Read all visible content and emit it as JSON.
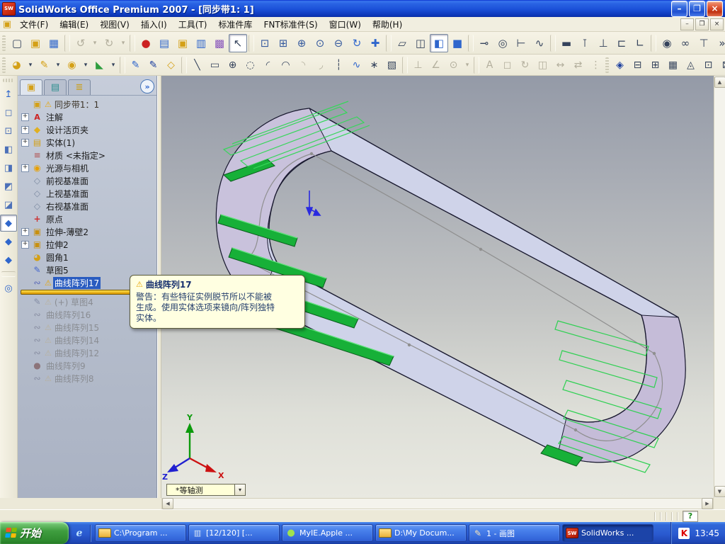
{
  "window": {
    "title": "SolidWorks Office Premium 2007 - [同步带1: 1]",
    "app_badge": "SW",
    "controls": {
      "min": "–",
      "restore": "❐",
      "close": "×"
    }
  },
  "menu": {
    "items": [
      "文件(F)",
      "编辑(E)",
      "视图(V)",
      "插入(I)",
      "工具(T)",
      "标准件库",
      "FNT标准件(S)",
      "窗口(W)",
      "帮助(H)"
    ],
    "doc_icon_glyph": "▣"
  },
  "toolbar_standard": {
    "icons": [
      {
        "n": "toolbar-grip",
        "g": "",
        "c": "grip",
        "inter": "false"
      },
      {
        "n": "new-document-icon",
        "g": "▢",
        "c": "c-ink"
      },
      {
        "n": "open-document-icon",
        "g": "▣",
        "c": "c-gold"
      },
      {
        "n": "save-icon",
        "g": "▦",
        "c": "c-blue"
      },
      {
        "n": "separator",
        "g": "",
        "c": "tsep",
        "inter": "false"
      },
      {
        "n": "undo-icon",
        "g": "↺",
        "c": "c-gray"
      },
      {
        "n": "undo-dropdown-icon",
        "g": "▾",
        "c": "c-gray dd"
      },
      {
        "n": "redo-icon",
        "g": "↻",
        "c": "c-gray"
      },
      {
        "n": "redo-dropdown-icon",
        "g": "▾",
        "c": "c-gray dd"
      },
      {
        "n": "separator",
        "g": "",
        "c": "tsep",
        "inter": "false"
      },
      {
        "n": "rebuild-traffic-light-icon",
        "g": "●",
        "c": "c-traffic"
      },
      {
        "n": "file-properties-icon",
        "g": "▤",
        "c": "c-blue"
      },
      {
        "n": "design-library-icon",
        "g": "▣",
        "c": "c-gold"
      },
      {
        "n": "task-list-icon",
        "g": "▥",
        "c": "c-blue"
      },
      {
        "n": "color-palette-icon",
        "g": "▩",
        "c": "c-purple"
      },
      {
        "n": "select-arrow-icon",
        "g": "↖",
        "c": "c-ink pressed"
      },
      {
        "n": "separator",
        "g": "",
        "c": "tsep",
        "inter": "false"
      },
      {
        "n": "zoom-to-fit-icon",
        "g": "⊡",
        "c": "c-zoom"
      },
      {
        "n": "zoom-to-area-icon",
        "g": "⊞",
        "c": "c-zoom"
      },
      {
        "n": "zoom-in-out-icon",
        "g": "⊕",
        "c": "c-zoom"
      },
      {
        "n": "zoom-to-selection-icon",
        "g": "⊙",
        "c": "c-zoom"
      },
      {
        "n": "zoom-out-icon",
        "g": "⊖",
        "c": "c-zoom"
      },
      {
        "n": "rotate-view-icon",
        "g": "↻",
        "c": "c-blue"
      },
      {
        "n": "pan-icon",
        "g": "✚",
        "c": "c-blue"
      },
      {
        "n": "separator",
        "g": "",
        "c": "tsep",
        "inter": "false"
      },
      {
        "n": "wireframe-icon",
        "g": "▱",
        "c": "c-ink"
      },
      {
        "n": "hidden-lines-icon",
        "g": "◫",
        "c": "c-ink"
      },
      {
        "n": "shaded-with-edges-icon",
        "g": "◧",
        "c": "c-blue pressed"
      },
      {
        "n": "shaded-icon",
        "g": "■",
        "c": "c-blue"
      },
      {
        "n": "separator",
        "g": "",
        "c": "tsep",
        "inter": "false"
      },
      {
        "n": "bolt-icon",
        "g": "⊸",
        "c": "c-ink"
      },
      {
        "n": "nut-icon",
        "g": "◎",
        "c": "c-ink"
      },
      {
        "n": "screw-icon",
        "g": "⊢",
        "c": "c-ink"
      },
      {
        "n": "spring-icon",
        "g": "∿",
        "c": "c-ink"
      },
      {
        "n": "separator",
        "g": "",
        "c": "tsep",
        "inter": "false"
      },
      {
        "n": "slot-icon",
        "g": "▬",
        "c": "c-ink"
      },
      {
        "n": "pin-icon",
        "g": "⊺",
        "c": "c-ink"
      },
      {
        "n": "support-pin-icon",
        "g": "⊥",
        "c": "c-ink"
      },
      {
        "n": "bracket-icon",
        "g": "⊏",
        "c": "c-ink"
      },
      {
        "n": "angle-profile-icon",
        "g": "∟",
        "c": "c-ink"
      },
      {
        "n": "separator",
        "g": "",
        "c": "tsep",
        "inter": "false"
      },
      {
        "n": "bearing-icon",
        "g": "◉",
        "c": "c-ink"
      },
      {
        "n": "link-icon",
        "g": "∞",
        "c": "c-ink"
      },
      {
        "n": "mount-icon",
        "g": "⊤",
        "c": "c-ink"
      },
      {
        "n": "toolbar-overflow-icon",
        "g": "»",
        "c": "c-ink"
      }
    ]
  },
  "toolbar_sketch": {
    "icons": [
      {
        "n": "toolbar-grip",
        "g": "",
        "c": "grip",
        "inter": "false"
      },
      {
        "n": "features-flyout-icon",
        "g": "◕",
        "c": "c-gold"
      },
      {
        "n": "features-dropdown-icon",
        "g": "▾",
        "c": "c-ink dd"
      },
      {
        "n": "sketch-flyout-icon",
        "g": "✎",
        "c": "c-gold"
      },
      {
        "n": "sketch-flyout-dropdown-icon",
        "g": "▾",
        "c": "c-ink dd"
      },
      {
        "n": "toolbox-flyout-icon",
        "g": "◉",
        "c": "c-gold"
      },
      {
        "n": "toolbox-dropdown-icon",
        "g": "▾",
        "c": "c-ink dd"
      },
      {
        "n": "weldment-flyout-icon",
        "g": "◣",
        "c": "c-green"
      },
      {
        "n": "weldment-dropdown-icon",
        "g": "▾",
        "c": "c-ink dd"
      },
      {
        "n": "separator",
        "g": "",
        "c": "tsep",
        "inter": "false"
      },
      {
        "n": "sketch-icon",
        "g": "✎",
        "c": "c-blue"
      },
      {
        "n": "sketch-3d-icon",
        "g": "✎",
        "c": "c-navy"
      },
      {
        "n": "modify-sketch-icon",
        "g": "◇",
        "c": "c-gold"
      },
      {
        "n": "separator",
        "g": "",
        "c": "tsep",
        "inter": "false"
      },
      {
        "n": "line-icon",
        "g": "╲",
        "c": "c-ink"
      },
      {
        "n": "rectangle-icon",
        "g": "▭",
        "c": "c-ink"
      },
      {
        "n": "circle-icon",
        "g": "⊕",
        "c": "c-ink"
      },
      {
        "n": "perimeter-circle-icon",
        "g": "◌",
        "c": "c-ink"
      },
      {
        "n": "centerpoint-arc-icon",
        "g": "◜",
        "c": "c-ink"
      },
      {
        "n": "tangent-arc-icon",
        "g": "◠",
        "c": "c-ink"
      },
      {
        "n": "three-point-arc-icon",
        "g": "◝",
        "c": "c-gray"
      },
      {
        "n": "sketch-fillet-icon",
        "g": "◞",
        "c": "c-gray"
      },
      {
        "n": "centerline-icon",
        "g": "┆",
        "c": "c-ink"
      },
      {
        "n": "spline-icon",
        "g": "∿",
        "c": "c-blue"
      },
      {
        "n": "point-icon",
        "g": "∗",
        "c": "c-ink"
      },
      {
        "n": "hatch-icon",
        "g": "▧",
        "c": "c-ink"
      },
      {
        "n": "separator",
        "g": "",
        "c": "tsep",
        "inter": "false"
      },
      {
        "n": "pierce-constraint-icon",
        "g": "⊥",
        "c": "c-gray"
      },
      {
        "n": "coordinate-system-icon",
        "g": "∠",
        "c": "c-gray"
      },
      {
        "n": "reference-circle-icon",
        "g": "⊙",
        "c": "c-gray"
      },
      {
        "n": "reference-dropdown-icon",
        "g": "▾",
        "c": "c-gray dd"
      },
      {
        "n": "separator",
        "g": "",
        "c": "tsep",
        "inter": "false"
      },
      {
        "n": "note-icon",
        "g": "A",
        "c": "c-gray"
      },
      {
        "n": "block-icon",
        "g": "◻",
        "c": "c-gray"
      },
      {
        "n": "rotate-entities-icon",
        "g": "↻",
        "c": "c-gray"
      },
      {
        "n": "mirror-entities-icon",
        "g": "◫",
        "c": "c-gray"
      },
      {
        "n": "move-entities-icon",
        "g": "↔",
        "c": "c-gray"
      },
      {
        "n": "pattern-entities-icon",
        "g": "⇄",
        "c": "c-gray"
      },
      {
        "n": "ordinate-icon",
        "g": "⋮",
        "c": "c-gray"
      },
      {
        "n": "toolbar-grip",
        "g": "",
        "c": "grip",
        "inter": "false"
      },
      {
        "n": "smart-dimension-icon",
        "g": "◈",
        "c": "c-navy"
      },
      {
        "n": "weld-bead-icon",
        "g": "⊟",
        "c": "c-ink"
      },
      {
        "n": "table-icon",
        "g": "⊞",
        "c": "c-ink"
      },
      {
        "n": "grid-system-icon",
        "g": "▦",
        "c": "c-ink"
      },
      {
        "n": "revision-symbol-icon",
        "g": "◬",
        "c": "c-ink"
      },
      {
        "n": "balloon-icon",
        "g": "⊡",
        "c": "c-ink"
      },
      {
        "n": "datum-icon",
        "g": "⊠",
        "c": "c-ink"
      },
      {
        "n": "toolbar-overflow-icon",
        "g": "»",
        "c": "c-ink"
      },
      {
        "n": "toolbar-grip",
        "g": "",
        "c": "grip",
        "inter": "false"
      },
      {
        "n": "omega-simulation-icon",
        "g": "Ω",
        "c": "c-navy"
      },
      {
        "n": "toolbar-overflow-icon",
        "g": "»",
        "c": "c-ink"
      }
    ]
  },
  "view_toolbar": {
    "icons": [
      {
        "n": "toolbar-grip",
        "g": "",
        "c": "grip",
        "inter": "false"
      },
      {
        "n": "normal-to-icon",
        "g": "↥",
        "c": "c-blue"
      },
      {
        "n": "front-view-icon",
        "g": "◻",
        "c": "c-vb"
      },
      {
        "n": "back-view-icon",
        "g": "⊡",
        "c": "c-vb"
      },
      {
        "n": "left-view-icon",
        "g": "◧",
        "c": "c-vb"
      },
      {
        "n": "right-view-icon",
        "g": "◨",
        "c": "c-vb"
      },
      {
        "n": "top-view-icon",
        "g": "◩",
        "c": "c-vb"
      },
      {
        "n": "bottom-view-icon",
        "g": "◪",
        "c": "c-vb"
      },
      {
        "n": "isometric-view-icon",
        "g": "◆",
        "c": "c-blue pressed"
      },
      {
        "n": "trimetric-view-icon",
        "g": "◆",
        "c": "c-blue"
      },
      {
        "n": "dimetric-view-icon",
        "g": "◆",
        "c": "c-blue"
      },
      {
        "n": "separator",
        "g": "",
        "c": "tsep",
        "inter": "false"
      },
      {
        "n": "view-orientation-icon",
        "g": "◎",
        "c": "c-blue"
      }
    ]
  },
  "panel": {
    "tabs": [
      {
        "n": "featuremanager-tab-icon",
        "g": "▣",
        "c": "c-gold on"
      },
      {
        "n": "propertymanager-tab-icon",
        "g": "▤",
        "c": "c-teal"
      },
      {
        "n": "configurationmanager-tab-icon",
        "g": "≣",
        "c": "c-gold2"
      }
    ],
    "overflow_glyph": "»",
    "tree_top": [
      {
        "st": "root",
        "exp": "",
        "g": "▣",
        "c": "i-part",
        "warn": "⚠",
        "label": "同步带1：1"
      },
      {
        "exp": "+",
        "g": "A",
        "c": "i-annot",
        "warn": "",
        "label": "注解"
      },
      {
        "exp": "+",
        "g": "◆",
        "c": "i-binder",
        "warn": "",
        "label": "设计活页夹"
      },
      {
        "exp": "+",
        "g": "▤",
        "c": "i-solids",
        "warn": "",
        "label": "实体(1)"
      },
      {
        "exp": "",
        "g": "≡",
        "c": "i-material",
        "warn": "",
        "label": "材质 <未指定>"
      },
      {
        "exp": "+",
        "g": "◉",
        "c": "i-lights",
        "warn": "",
        "label": "光源与相机"
      },
      {
        "exp": "",
        "g": "◇",
        "c": "i-plane",
        "warn": "",
        "label": "前视基准面"
      },
      {
        "exp": "",
        "g": "◇",
        "c": "i-plane",
        "warn": "",
        "label": "上视基准面"
      },
      {
        "exp": "",
        "g": "◇",
        "c": "i-plane",
        "warn": "",
        "label": "右视基准面"
      },
      {
        "exp": "",
        "g": "+",
        "c": "i-origin",
        "warn": "",
        "label": "原点"
      },
      {
        "exp": "+",
        "g": "▣",
        "c": "i-extrude",
        "warn": "",
        "label": "拉伸-薄壁2"
      },
      {
        "exp": "+",
        "g": "▣",
        "c": "i-extrude",
        "warn": "",
        "label": "拉伸2"
      },
      {
        "exp": "",
        "g": "◕",
        "c": "i-fillet",
        "warn": "",
        "label": "圆角1"
      },
      {
        "exp": "",
        "g": "✎",
        "c": "i-sketch",
        "warn": "",
        "label": "草图5"
      },
      {
        "st": "sel",
        "exp": "",
        "g": "∾",
        "c": "i-pattern",
        "warn": "⚠",
        "label": "曲线阵列17"
      }
    ],
    "tree_bottom": [
      {
        "st": "gray",
        "exp": "",
        "g": "✎",
        "c": "i-sketch",
        "warn": "⚠",
        "label": "(+) 草图4"
      },
      {
        "st": "gray",
        "exp": "",
        "g": "∾",
        "c": "i-pattern",
        "warn": "",
        "label": "曲线阵列16"
      },
      {
        "st": "gray",
        "exp": "",
        "g": "∾",
        "c": "i-pattern",
        "warn": "⚠",
        "label": "曲线阵列15"
      },
      {
        "st": "gray",
        "exp": "",
        "g": "∾",
        "c": "i-pattern",
        "warn": "⚠",
        "label": "曲线阵列14"
      },
      {
        "st": "gray",
        "exp": "",
        "g": "∾",
        "c": "i-pattern",
        "warn": "⚠",
        "label": "曲线阵列12"
      },
      {
        "st": "gray",
        "exp": "",
        "g": "●",
        "c": "i-traffic",
        "warn": "",
        "label": "曲线阵列9"
      },
      {
        "st": "gray",
        "exp": "",
        "g": "∾",
        "c": "i-pattern",
        "warn": "⚠",
        "label": "曲线阵列8"
      }
    ]
  },
  "tooltip": {
    "warn": "⚠",
    "title": "曲线阵列17",
    "line1": "警告：有些特征实例脱节所以不能被",
    "line2": "生成。使用实体选项来镜向/阵列独特",
    "line3": "实体。"
  },
  "viewport": {
    "view_selector": "*等轴测",
    "dropdown_arrow": "▾",
    "triad": {
      "x": "X",
      "y": "Y",
      "z": "Z"
    },
    "scroll": {
      "up": "▲",
      "down": "▼",
      "left": "◀",
      "right": "▶"
    }
  },
  "statusbar": {
    "help": "?"
  },
  "taskbar": {
    "start_label": "开始",
    "quick": [
      {
        "n": "internet-explorer-icon",
        "g": "e",
        "c": "ti-ie"
      }
    ],
    "tasks": [
      {
        "n": "task-explorer-c",
        "g": "",
        "c": "ti-folder",
        "label": "C:\\Program ...",
        "st": ""
      },
      {
        "n": "task-image-viewer",
        "g": "▥",
        "c": "ti-viewer",
        "label": "[12/120] [...",
        "st": ""
      },
      {
        "n": "task-myie-browser",
        "g": "●",
        "c": "ti-myie",
        "label": "MyIE.Apple ...",
        "st": ""
      },
      {
        "n": "task-explorer-d",
        "g": "",
        "c": "ti-folder",
        "label": "D:\\My Docum...",
        "st": ""
      },
      {
        "n": "task-paint",
        "g": "✎",
        "c": "ti-paint",
        "label": "1 - 画图",
        "st": ""
      },
      {
        "n": "task-solidworks",
        "g": "SW",
        "c": "ti-sw",
        "label": "SolidWorks ...",
        "st": "active"
      }
    ],
    "tray": {
      "kaspersky_glyph": "K",
      "clock": "13:45"
    }
  },
  "colors": {
    "selection_blue": "#2a5cc0",
    "belt_face": "#cfd3e9",
    "teeth_green": "#17b038",
    "preview_green": "#33d455",
    "rollback_yellow": "#e8a800",
    "taskbar_blue": "#2a5ad0",
    "titlebar_blue": "#1b50d8"
  }
}
